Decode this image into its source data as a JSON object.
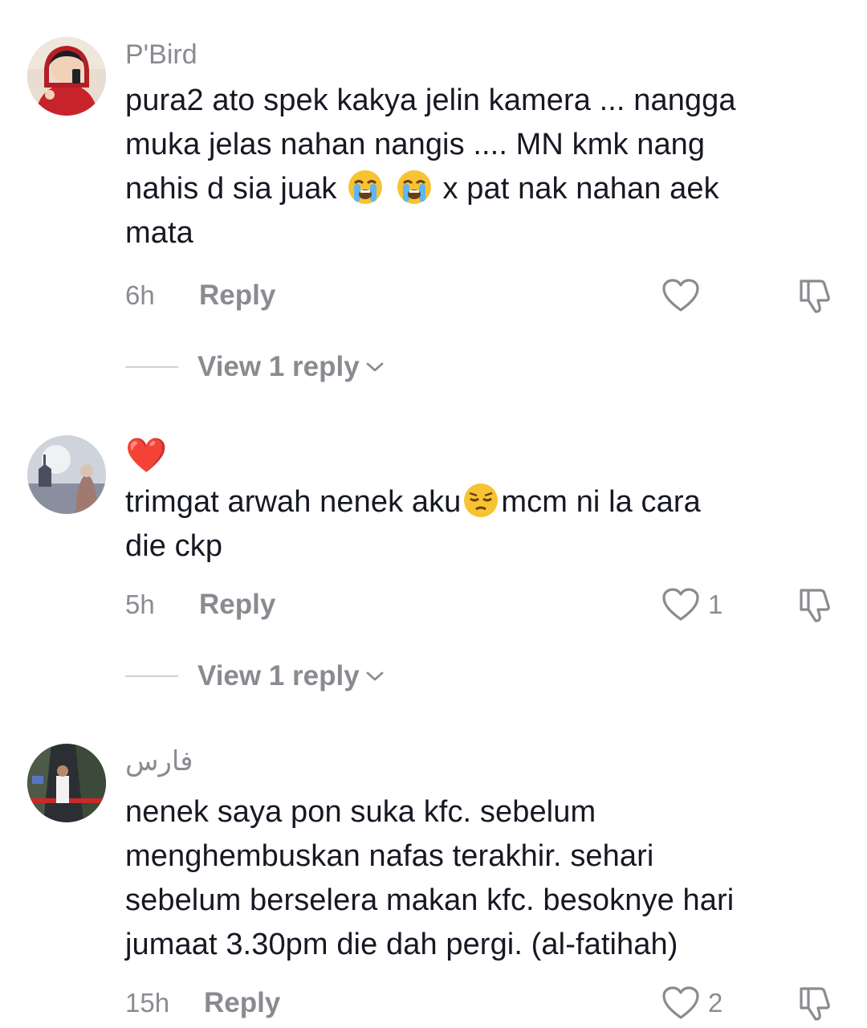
{
  "comments": [
    {
      "username": "P'Bird",
      "text_parts": [
        "pura2 ato spek kakya jelin kamera ... nangga\nmuka jelas nahan nangis .... MN kmk nang\nnahis d sia juak ",
        " ",
        " x pat nak nahan aek\nmata"
      ],
      "emojis": [
        "loudly-crying-face",
        "loudly-crying-face"
      ],
      "time": "6h",
      "reply_label": "Reply",
      "likes": "",
      "view_replies": "View 1 reply"
    },
    {
      "username": "❤️",
      "text_parts": [
        "trimgat arwah nenek aku",
        "mcm ni la cara\ndie ckp"
      ],
      "emojis": [
        "pensive-face"
      ],
      "time": "5h",
      "reply_label": "Reply",
      "likes": "1",
      "view_replies": "View 1 reply"
    },
    {
      "username": "فارس",
      "text_parts": [
        "nenek saya pon suka kfc. sebelum\nmenghembuskan nafas terakhir. sehari\nsebelum berselera makan kfc. besoknye hari\njumaat 3.30pm die dah pergi. (al-fatihah)"
      ],
      "emojis": [],
      "time": "15h",
      "reply_label": "Reply",
      "likes": "2",
      "view_replies": ""
    }
  ],
  "colors": {
    "text": "#161823",
    "muted": "#8a8b91",
    "heart_red": "#e01b2b",
    "divider": "#d0d1d3"
  },
  "icons": {
    "like": "heart-outline-icon",
    "dislike": "thumbs-down-outline-icon",
    "expand": "chevron-down-icon"
  }
}
